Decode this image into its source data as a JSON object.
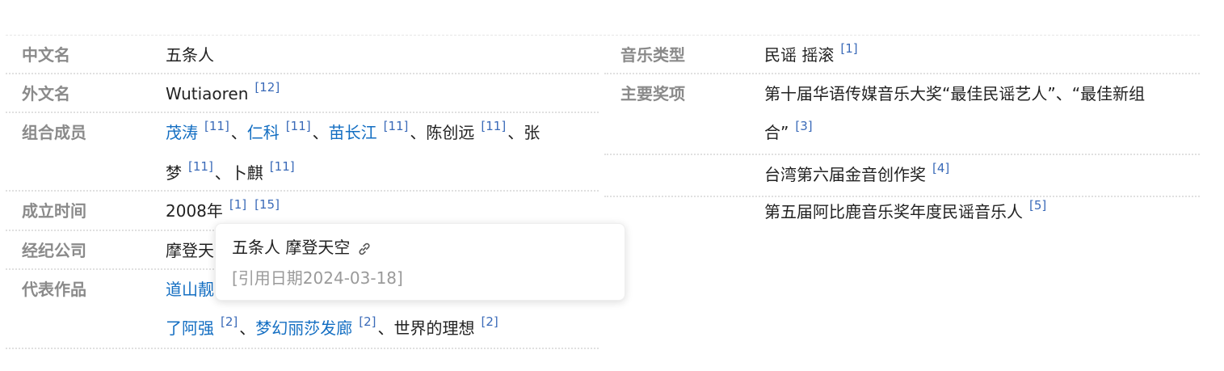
{
  "left_rows": [
    {
      "label": "中文名",
      "value": "五条人"
    },
    {
      "label": "外文名",
      "value": "Wutiaoren",
      "ref": "[12]"
    },
    {
      "label": "组合成员",
      "members": [
        {
          "name": "茂涛",
          "ref": "[11]"
        },
        {
          "name": "仁科",
          "ref": "[11]"
        },
        {
          "name": "苗长江",
          "ref": "[11]"
        },
        {
          "name": "陈创远",
          "ref": "[11]"
        },
        {
          "name_part1": "张",
          "name_part2": "梦",
          "ref": "[11]"
        },
        {
          "name": "卜麒",
          "ref": "[11]"
        }
      ],
      "separator": "、"
    },
    {
      "label": "成立时间",
      "value": "2008年",
      "refs": [
        "[1]",
        "[15]"
      ]
    },
    {
      "label": "经纪公司",
      "value_visible": "摩登天"
    },
    {
      "label": "代表作品",
      "works_line1_visible": "道山靓",
      "works": [
        {
          "title": "了阿强",
          "ref": "[2]"
        },
        {
          "title": "梦幻丽莎发廊",
          "ref": "[2]"
        },
        {
          "title": "世界的理想",
          "ref": "[2]"
        }
      ]
    }
  ],
  "right_rows": [
    {
      "label": "音乐类型",
      "value": "民谣 摇滚",
      "ref": "[1]"
    },
    {
      "label": "主要奖项",
      "awards": [
        {
          "line1": "第十届华语传媒音乐大奖“最佳民谣艺人”、“最佳新组",
          "line2": "合”",
          "ref": "[3]"
        },
        {
          "text": "台湾第六届金音创作奖",
          "ref": "[4]"
        },
        {
          "text": "第五届阿比鹿音乐奖年度民谣音乐人",
          "ref": "[5]"
        }
      ]
    }
  ],
  "tooltip": {
    "title": "五条人 摩登天空",
    "icon": "link-icon",
    "date": "[引用日期2024-03-18]"
  },
  "colors": {
    "link": "#136ec2",
    "label": "#8a8a8a",
    "ref": "#3a6ab8",
    "muted": "#9a9a9a"
  }
}
